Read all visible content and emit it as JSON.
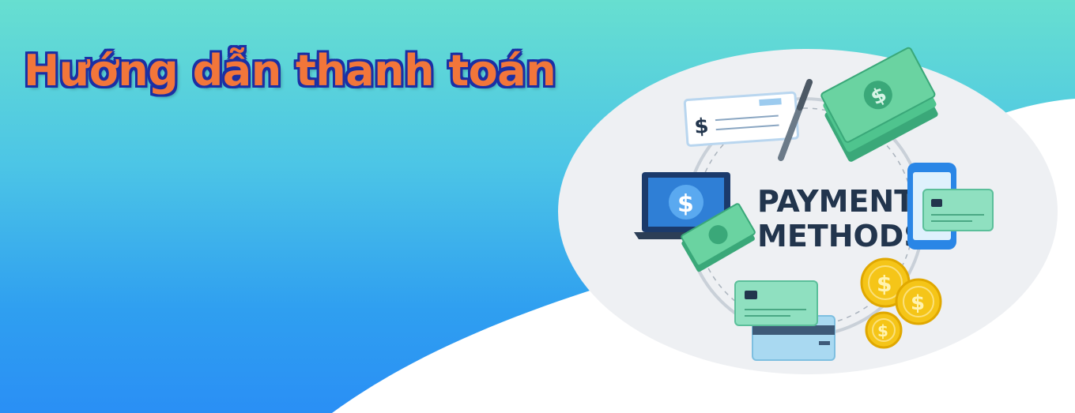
{
  "banner": {
    "title": "Hướng dẫn thanh toán"
  },
  "illustration": {
    "line1": "PAYMENT",
    "line2": "METHODS",
    "dollar_symbol": "$",
    "icons": [
      "check-icon",
      "pen-icon",
      "banknotes-icon",
      "laptop-icon",
      "smartphone-icon",
      "credit-card-icon",
      "coins-icon"
    ]
  },
  "colors": {
    "title_fill": "#f2763a",
    "title_outline": "#1b2fa4",
    "heading_text": "#22354d",
    "money_green": "#4fc48e",
    "device_blue": "#1e6fd0",
    "coin_gold": "#f5c518"
  }
}
